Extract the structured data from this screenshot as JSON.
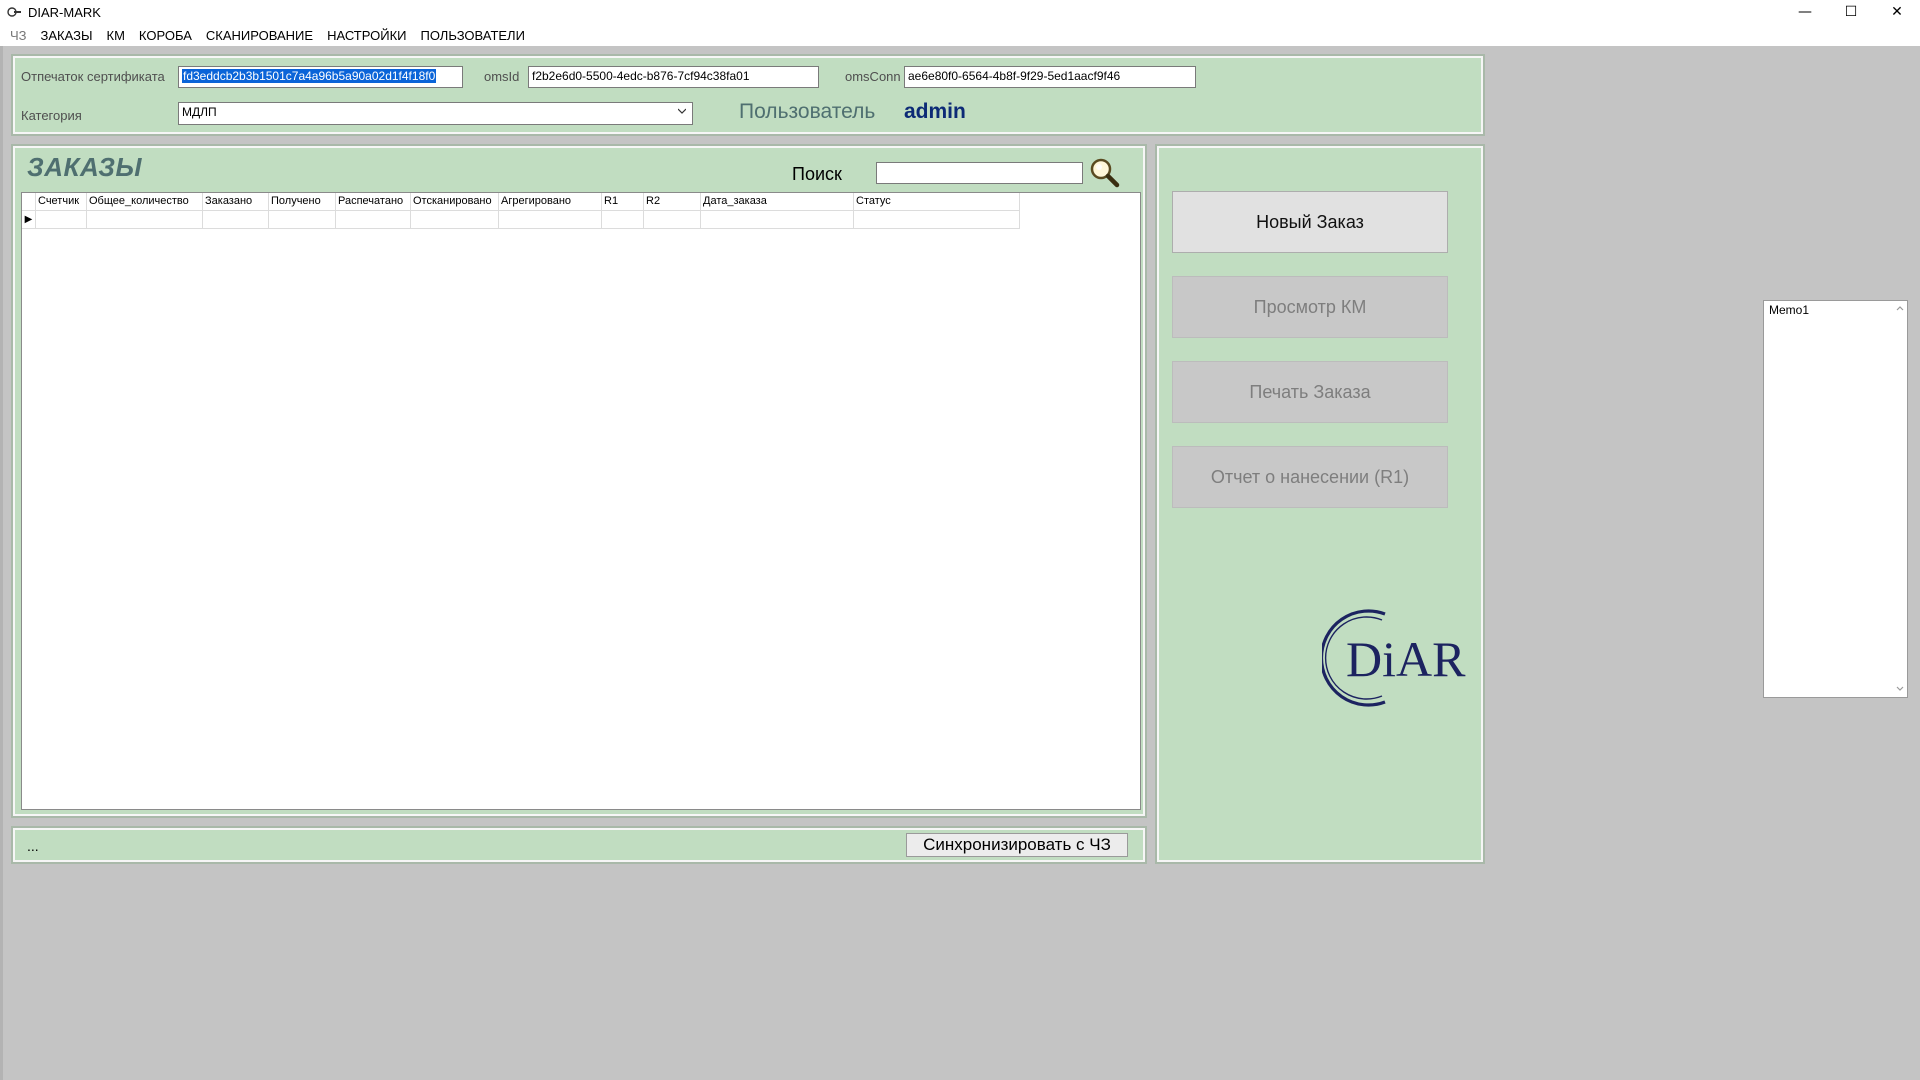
{
  "window": {
    "title": "DIAR-MARK",
    "minimize_symbol": "—",
    "maximize_symbol": "☐",
    "close_symbol": "✕"
  },
  "menu": {
    "items": [
      {
        "label": "ЧЗ",
        "enabled": false
      },
      {
        "label": "ЗАКАЗЫ",
        "enabled": true
      },
      {
        "label": "КМ",
        "enabled": true
      },
      {
        "label": "КОРОБА",
        "enabled": true
      },
      {
        "label": "СКАНИРОВАНИЕ",
        "enabled": true
      },
      {
        "label": "НАСТРОЙКИ",
        "enabled": true
      },
      {
        "label": "ПОЛЬЗОВАТЕЛИ",
        "enabled": true
      }
    ]
  },
  "header": {
    "cert_label": "Отпечаток сертификата",
    "cert_value": "fd3eddcb2b3b1501c7a4a96b5a90a02d1f4f18f0",
    "oms_id_label": "omsId",
    "oms_id_value": "f2b2e6d0-5500-4edc-b876-7cf94c38fa01",
    "oms_conn_label": "omsConn",
    "oms_conn_value": "ae6e80f0-6564-4b8f-9f29-5ed1aacf9f46",
    "category_label": "Категория",
    "category_value": "МДЛП",
    "user_label": "Пользователь",
    "user_value": "admin"
  },
  "orders": {
    "title": "ЗАКАЗЫ",
    "search_label": "Поиск",
    "search_value": "",
    "columns": [
      "Счетчик",
      "Общее_количество",
      "Заказано",
      "Получено",
      "Распечатано",
      "Отсканировано",
      "Агрегировано",
      "R1",
      "R2",
      "Дата_заказа",
      "Статус"
    ],
    "row_marker": "▶",
    "status_text": "...",
    "sync_label": "Синхронизировать с ЧЗ"
  },
  "actions": {
    "new_order": "Новый Заказ",
    "view_km": "Просмотр КМ",
    "print_order": "Печать Заказа",
    "report_r1": "Отчет о нанесении (R1)"
  },
  "logo": {
    "text": "DiAR",
    "color": "#1c2360"
  },
  "memo": {
    "text": "Memo1"
  },
  "colors": {
    "panel": "#c1ddc1",
    "background": "#c4c4c4",
    "selection": "#0a64d8",
    "user_accent": "#0c2a76"
  }
}
